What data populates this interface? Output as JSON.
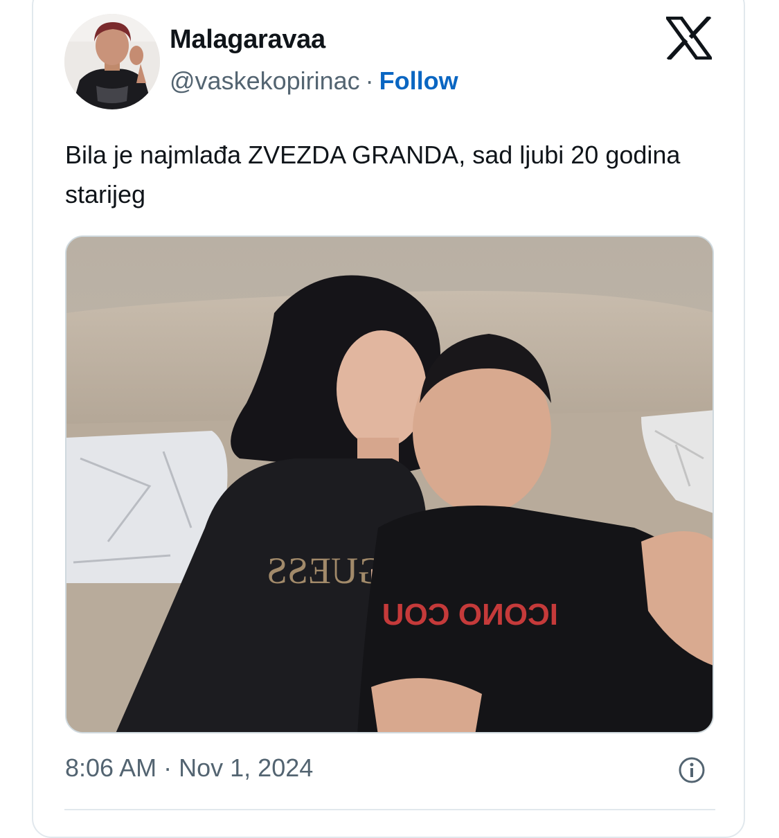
{
  "tweet": {
    "author": {
      "display_name": "Malagaravaa",
      "handle": "@vaskekopirinac",
      "separator": "·",
      "follow_label": "Follow",
      "avatar_icon": "user-avatar-photo"
    },
    "platform_logo": "x-logo-icon",
    "text": "Bila je najmlađa ZVEZDA GRANDA, sad ljubi 20 godina starijeg",
    "media": {
      "type": "photo",
      "shirt_left_text": "GUESS",
      "shirt_right_text": "ICONO COU"
    },
    "time": "8:06 AM",
    "time_separator": "·",
    "date": "Nov 1, 2024",
    "info_icon": "info-icon"
  },
  "colors": {
    "link_blue": "#0a66c2",
    "text_primary": "#0f1419",
    "text_secondary": "#536471",
    "border": "#e1e8ed"
  }
}
